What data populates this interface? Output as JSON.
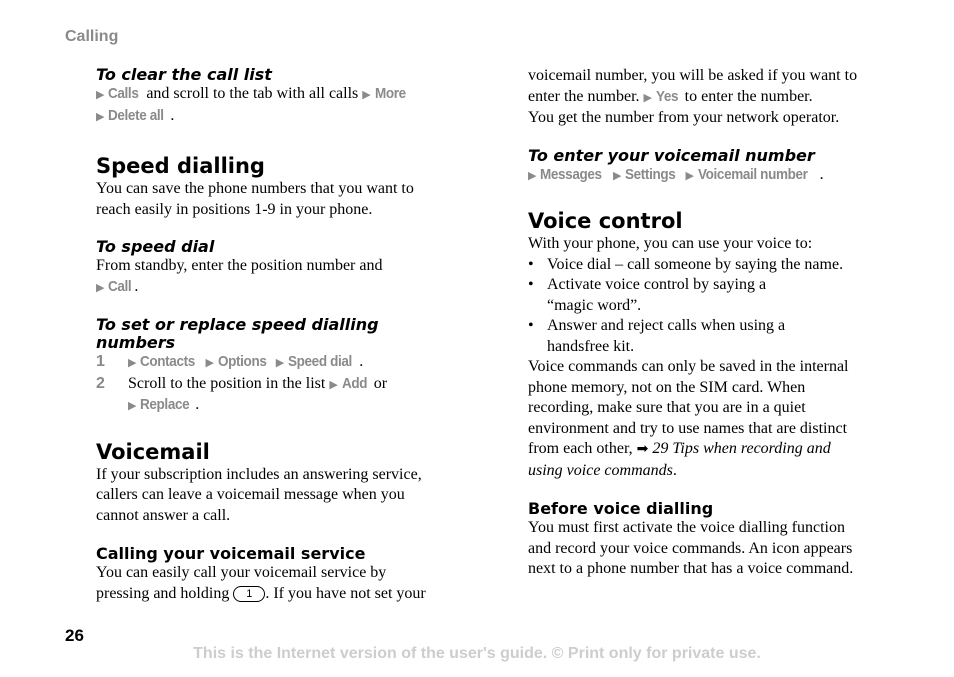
{
  "chapter": "Calling",
  "page_number": "26",
  "footer": "This is the Internet version of the user's guide. © Print only for private use.",
  "left": {
    "clear_call_list": {
      "heading": "To clear the call list",
      "menu_calls": "Calls",
      "text1": " and scroll to the tab with all calls ",
      "menu_more": "More",
      "menu_delete_all": "Delete all",
      "end": "."
    },
    "speed_dialling": {
      "heading": "Speed dialling",
      "body_line1": "You can save the phone numbers that you want to",
      "body_line2": "reach easily in positions 1-9 in your phone."
    },
    "to_speed_dial": {
      "heading": "To speed dial",
      "body_line1": "From standby, enter the position number and",
      "menu_call": "Call",
      "end": "."
    },
    "set_replace": {
      "heading_line1": "To set or replace speed dialling",
      "heading_line2": "numbers",
      "steps": [
        {
          "num": "1",
          "menu1": "Contacts",
          "menu2": "Options",
          "menu3": "Speed dial",
          "end": "."
        },
        {
          "num": "2",
          "text": "Scroll to the position in the list ",
          "menu_add": "Add",
          "or": " or",
          "menu_replace": "Replace",
          "end": "."
        }
      ]
    },
    "voicemail": {
      "heading": "Voicemail",
      "body_line1": "If your subscription includes an answering service,",
      "body_line2": "callers can leave a voicemail message when you",
      "body_line3": "cannot answer a call."
    },
    "calling_voicemail": {
      "heading": "Calling your voicemail service",
      "body_line1": "You can easily call your voicemail service by",
      "body_line2a": "pressing and holding ",
      "key_label": "1",
      "body_line2b": ". If you have not set your"
    }
  },
  "right": {
    "continued": {
      "line1": "voicemail number, you will be asked if you want to",
      "line2a": "enter the number. ",
      "menu_yes": "Yes",
      "line2b": " to enter the number.",
      "line3": "You get the number from your network operator."
    },
    "enter_voicemail": {
      "heading": "To enter your voicemail number",
      "menu1": "Messages",
      "menu2": "Settings",
      "menu3": "Voicemail number",
      "end": "."
    },
    "voice_control": {
      "heading": "Voice control",
      "intro": "With your phone, you can use your voice to:",
      "bullets": [
        {
          "line1": "Voice dial – call someone by saying the name."
        },
        {
          "line1": "Activate voice control by saying a",
          "line2": "“magic word”."
        },
        {
          "line1": "Answer and reject calls when using a",
          "line2": "handsfree kit."
        }
      ],
      "body_line1": "Voice commands can only be saved in the internal",
      "body_line2": "phone memory, not on the SIM card. When",
      "body_line3": "recording, make sure that you are in a quiet",
      "body_line4": "environment and try to use names that are distinct",
      "body_line5a": "from each other, ",
      "ref_icon": "arrow-right-icon",
      "ref_line5": " 29 Tips when recording and",
      "ref_line6": "using voice commands",
      "end": "."
    },
    "before_voice_dialling": {
      "heading": "Before voice dialling",
      "body_line1": "You must first activate the voice dialling function",
      "body_line2": "and record your voice commands. An icon appears",
      "body_line3": "next to a phone number that has a voice command."
    }
  },
  "icons": {
    "menu_arrow": "▶",
    "bullet": "•",
    "ref_arrow": "➡"
  }
}
